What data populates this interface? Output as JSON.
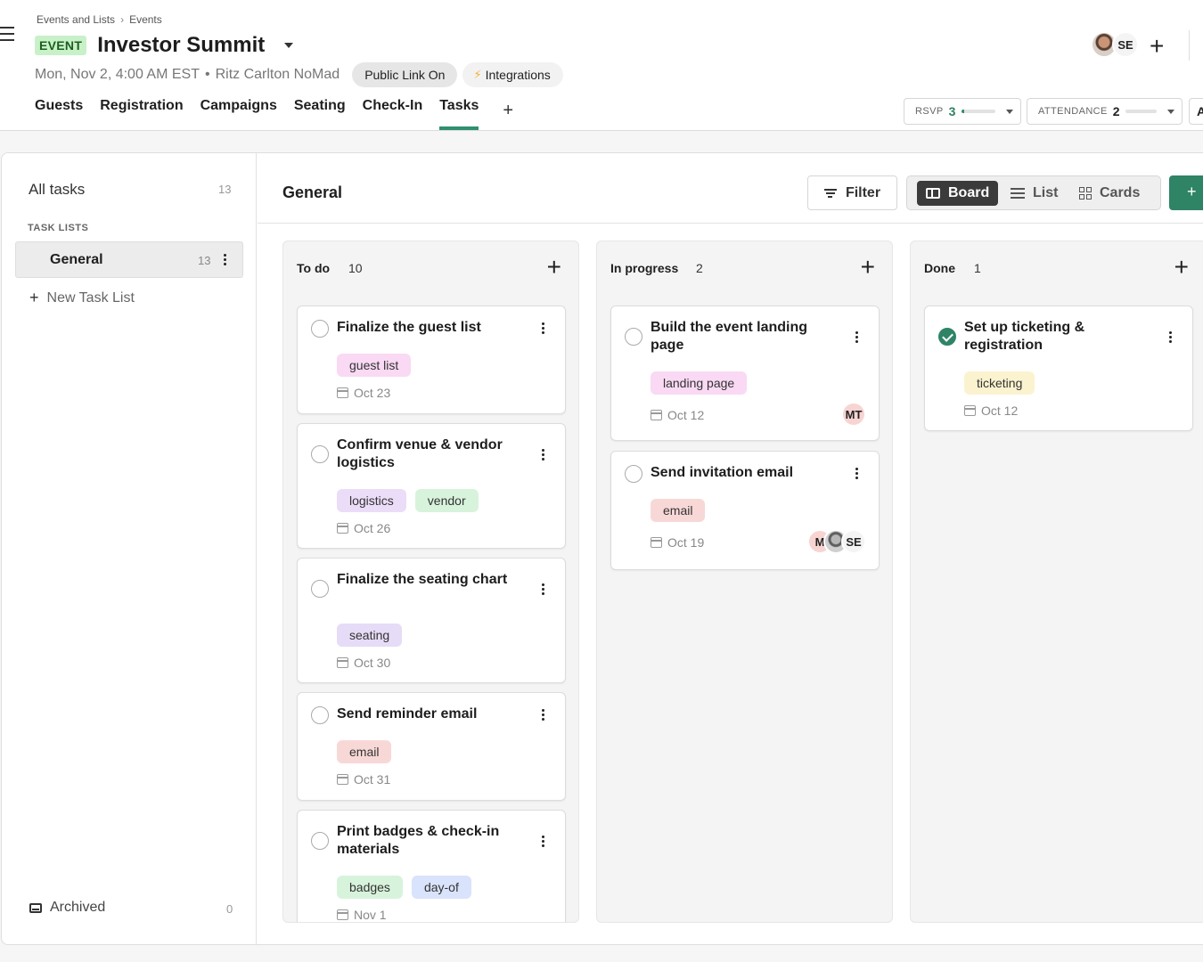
{
  "breadcrumb": [
    "Events and Lists",
    "Events"
  ],
  "event": {
    "badge": "EVENT",
    "title": "Investor Summit",
    "datetime": "Mon, Nov 2, 4:00 AM EST",
    "separator": "•",
    "venue": "Ritz Carlton NoMad",
    "public_link": "Public Link On",
    "integrations": "Integrations"
  },
  "nav_tabs": [
    "Guests",
    "Registration",
    "Campaigns",
    "Seating",
    "Check-In",
    "Tasks"
  ],
  "active_tab": "Tasks",
  "header_avatars": [
    {
      "initials": "",
      "type": "photo"
    },
    {
      "initials": "SE"
    }
  ],
  "stats": {
    "rsvp": {
      "label": "RSVP",
      "value": "3",
      "fill_fraction": 0.08
    },
    "attendance": {
      "label": "ATTENDANCE",
      "value": "2",
      "fill_fraction": 0.0
    },
    "cut_label": "A"
  },
  "sidebar": {
    "all_tasks": {
      "label": "All tasks",
      "count": "13"
    },
    "task_lists_heading": "TASK LISTS",
    "lists": [
      {
        "label": "General",
        "count": "13"
      }
    ],
    "new_list": "New Task List",
    "archived": {
      "label": "Archived",
      "count": "0"
    }
  },
  "board": {
    "title": "General",
    "filter_label": "Filter",
    "views": [
      "Board",
      "List",
      "Cards"
    ],
    "active_view": "Board",
    "add_label": "+"
  },
  "columns": [
    {
      "title": "To do",
      "count": "10",
      "cards": [
        {
          "title": "Finalize the guest list",
          "tags": [
            {
              "label": "guest list",
              "color": "#f9d9f3"
            }
          ],
          "due": "Oct 23",
          "done": false,
          "assignees": []
        },
        {
          "title": "Confirm venue & vendor logistics",
          "tags": [
            {
              "label": "logistics",
              "color": "#ebdcf8"
            },
            {
              "label": "vendor",
              "color": "#d8f3dc"
            }
          ],
          "due": "Oct 26",
          "done": false,
          "assignees": []
        },
        {
          "title": "Finalize the seating chart",
          "tags": [
            {
              "label": "seating",
              "color": "#e6dcf7"
            }
          ],
          "due": "Oct 30",
          "done": false,
          "assignees": []
        },
        {
          "title": "Send reminder email",
          "tags": [
            {
              "label": "email",
              "color": "#f8d8d6"
            }
          ],
          "due": "Oct 31",
          "done": false,
          "assignees": []
        },
        {
          "title": "Print badges & check-in materials",
          "tags": [
            {
              "label": "badges",
              "color": "#d8f3dc"
            },
            {
              "label": "day-of",
              "color": "#d9e3fb"
            }
          ],
          "due": "Nov 1",
          "done": false,
          "assignees": []
        }
      ]
    },
    {
      "title": "In progress",
      "count": "2",
      "cards": [
        {
          "title": "Build the event landing page",
          "tags": [
            {
              "label": "landing page",
              "color": "#f9d9f3"
            }
          ],
          "due": "Oct 12",
          "done": false,
          "assignees": [
            "MT"
          ]
        },
        {
          "title": "Send invitation email",
          "tags": [
            {
              "label": "email",
              "color": "#f8d8d6"
            }
          ],
          "due": "Oct 19",
          "done": false,
          "assignees": [
            "M",
            "photo",
            "SE"
          ]
        }
      ]
    },
    {
      "title": "Done",
      "count": "1",
      "cards": [
        {
          "title": "Set up ticketing & registration",
          "tags": [
            {
              "label": "ticketing",
              "color": "#fbf3cf"
            }
          ],
          "due": "Oct 12",
          "done": true,
          "assignees": []
        }
      ]
    }
  ],
  "colors": {
    "accent": "#2f8466",
    "active_view_bg": "#3b3b3b",
    "event_badge_bg": "#c9f1c9"
  }
}
